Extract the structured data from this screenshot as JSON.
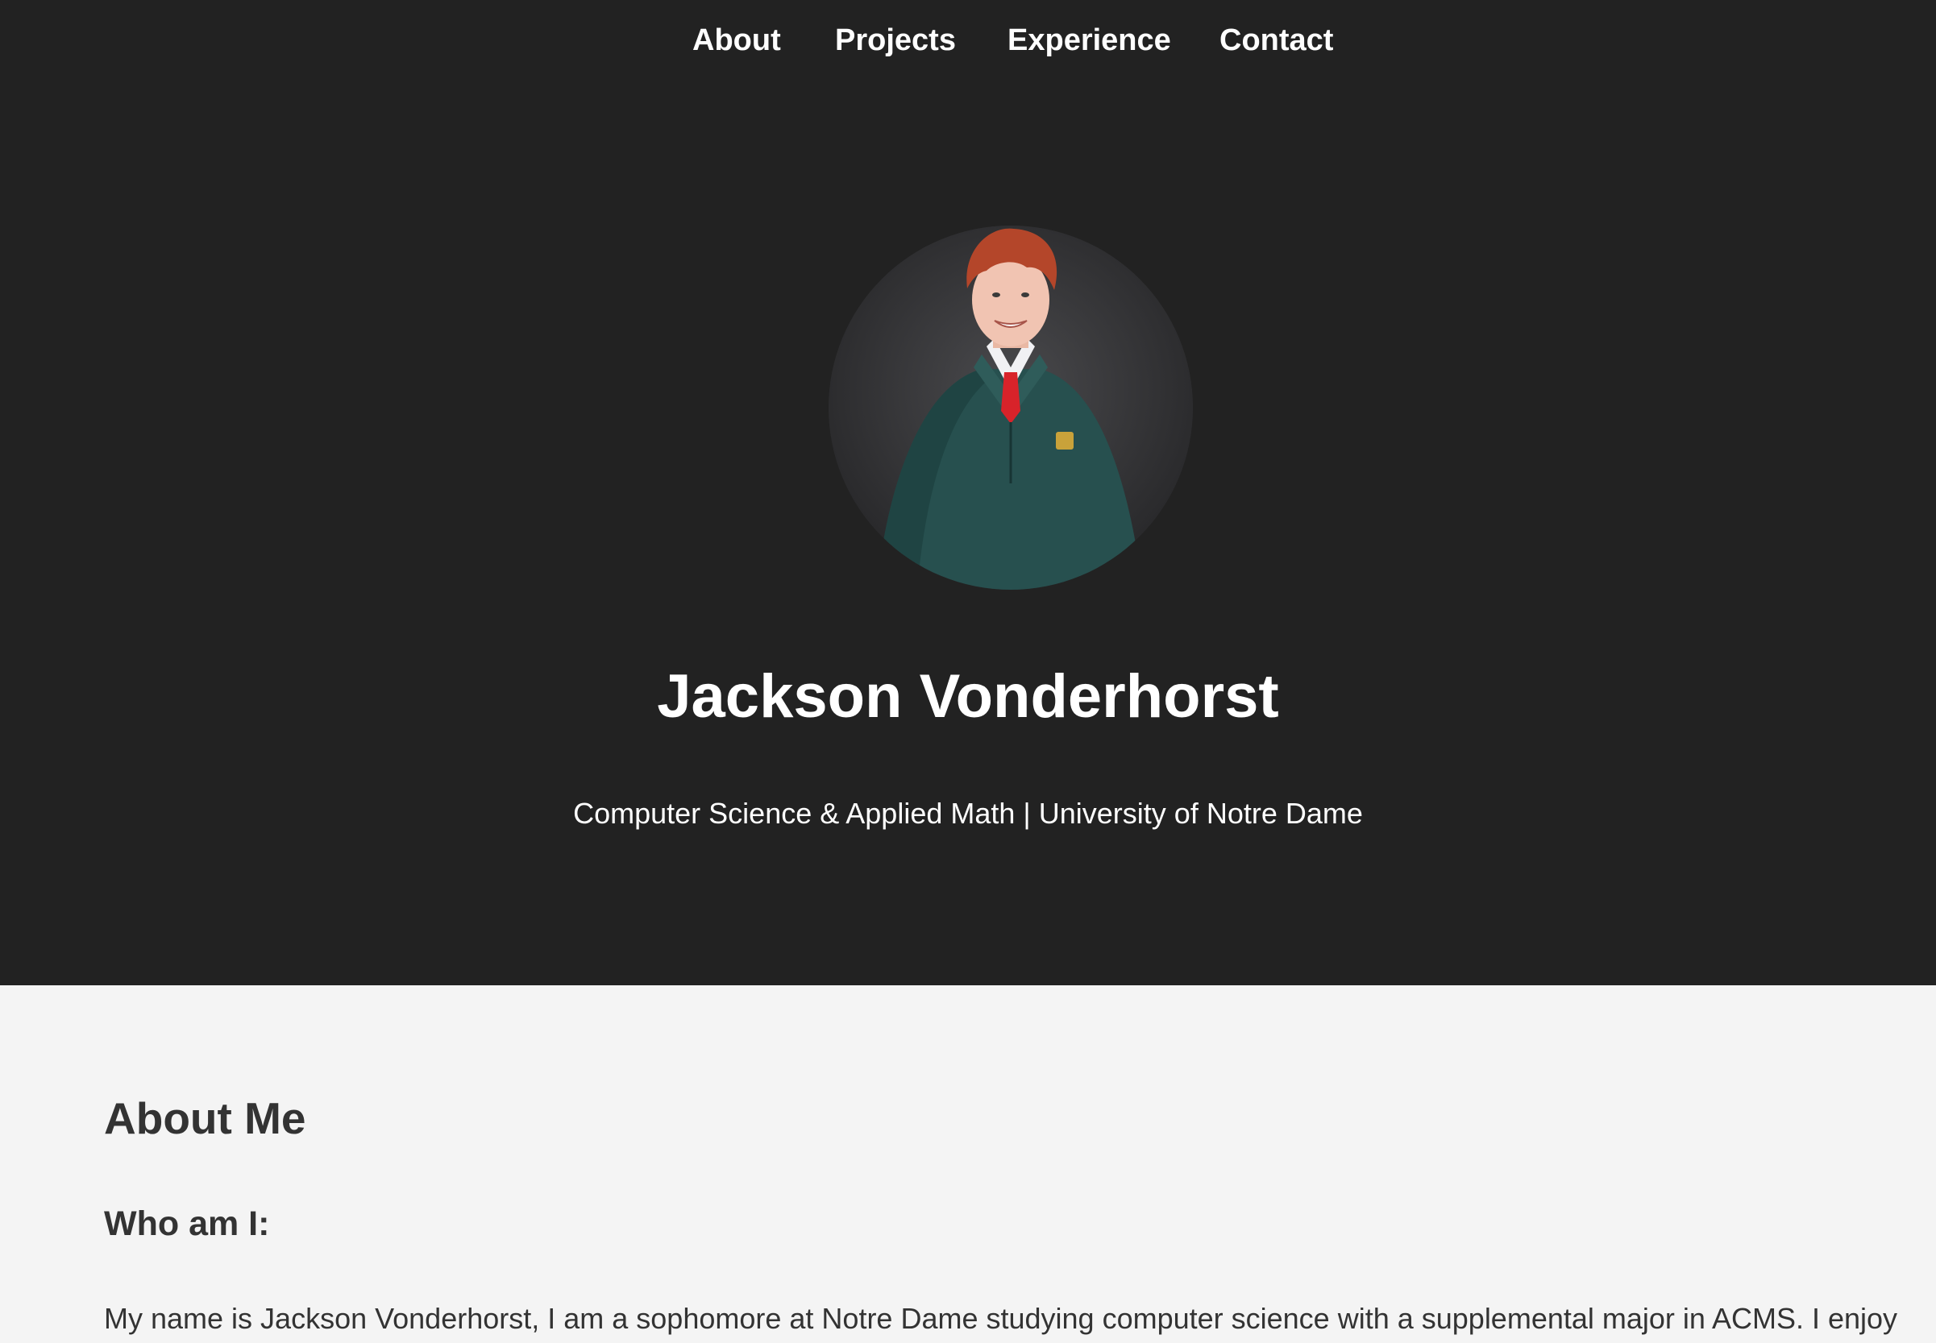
{
  "nav": {
    "items": [
      "About",
      "Projects",
      "Experience",
      "Contact"
    ]
  },
  "hero": {
    "name": "Jackson Vonderhorst",
    "subtitle": "Computer Science & Applied Math | University of Notre Dame"
  },
  "about": {
    "heading": "About Me",
    "subheading": "Who am I:",
    "paragraph": "My name is Jackson Vonderhorst, I am a sophomore at Notre Dame studying computer science with a supplemental major in ACMS. I enjoy"
  },
  "colors": {
    "hero_background": "#222222",
    "page_background": "#f4f4f4",
    "hero_text": "#ffffff",
    "body_text": "#333333"
  }
}
